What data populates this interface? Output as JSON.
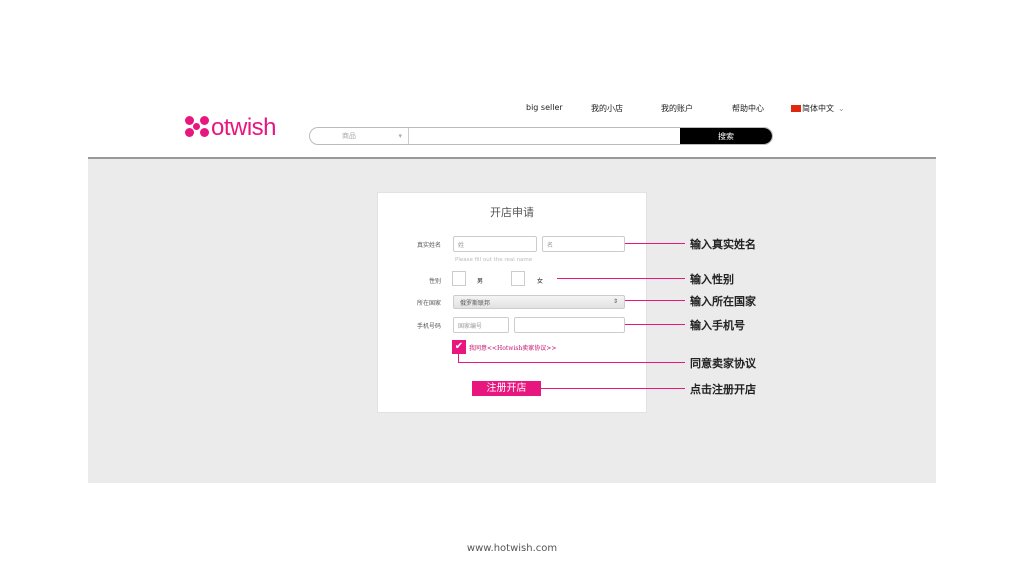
{
  "header": {
    "logo": "otwish",
    "nav": [
      "big seller",
      "我的小店",
      "我的账户",
      "帮助中心"
    ],
    "language": "简体中文",
    "search": {
      "category": "商品",
      "placeholder": "",
      "button": "搜索"
    }
  },
  "form": {
    "title": "开店申请",
    "name_label": "真实姓名",
    "surname_placeholder": "姓",
    "given_placeholder": "名",
    "name_hint": "Please fill out the real name",
    "gender_label": "性别",
    "male": "男",
    "female": "女",
    "country_label": "所在国家",
    "country_value": "俄罗斯联邦",
    "phone_label": "手机号码",
    "country_code_placeholder": "国家编号",
    "agree_text": "我同意<<Hotwish卖家协议>>",
    "agree_checked": true,
    "submit": "注册开店"
  },
  "annotations": [
    "输入真实姓名",
    "输入性别",
    "输入所在国家",
    "输入手机号",
    "同意卖家协议",
    "点击注册开店"
  ],
  "footer": "www.hotwish.com",
  "colors": {
    "accent": "#e8177f",
    "panel": "#ebebeb"
  }
}
